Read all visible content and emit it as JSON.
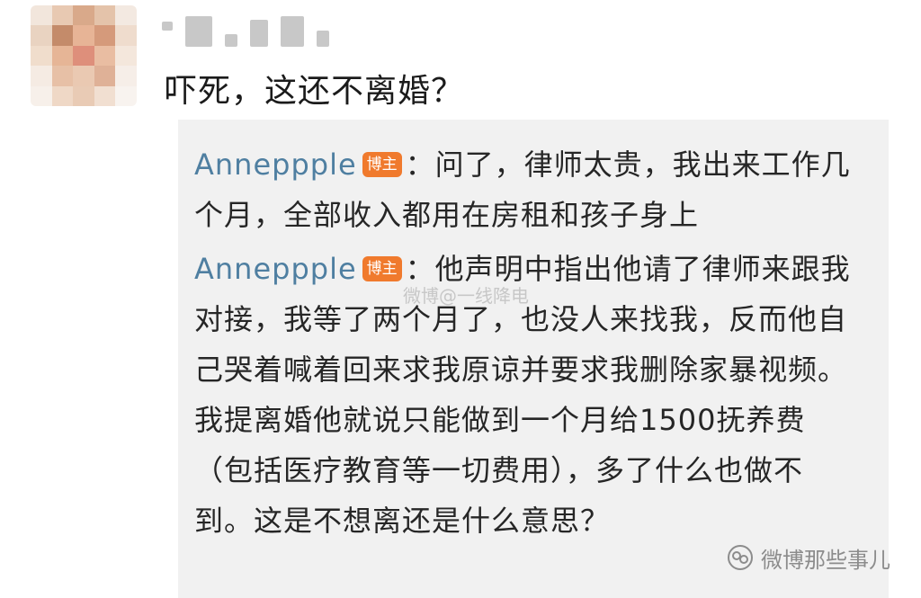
{
  "comment": {
    "avatar_icon": "avatar-mosaic",
    "username_icon": "blurred-username",
    "text": "吓死，这还不离婚？"
  },
  "replies": [
    {
      "name": "Anneppple",
      "badge": "博主",
      "text": "：问了，律师太贵，我出来工作几个月，全部收入都用在房租和孩子身上"
    },
    {
      "name": "Anneppple",
      "badge": "博主",
      "text": "：他声明中指出他请了律师来跟我对接，我等了两个月了，也没人来找我，反而他自己哭着喊着回来求我原谅并要求我删除家暴视频。我提离婚他就说只能做到一个月给1500抚养费（包括医疗教育等一切费用），多了什么也做不到。这是不想离还是什么意思？"
    }
  ],
  "watermarks": {
    "middle": "微博@一线降电",
    "bottom_right": "微博那些事儿",
    "bottom_right_icon": "wechat-official-account-icon"
  },
  "colors": {
    "name": "#4f7fa1",
    "badge": "#f07a2d",
    "reply_bg": "#f1f1f1",
    "text": "#262626"
  }
}
